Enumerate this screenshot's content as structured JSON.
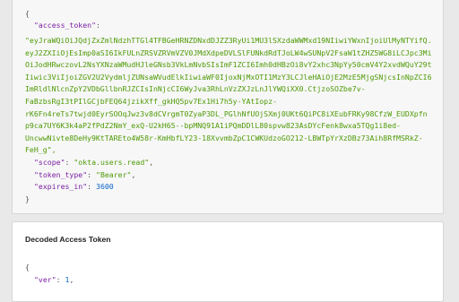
{
  "access_token_card": {
    "open_brace": "{",
    "close_brace": "}",
    "access_token_key": "\"access_token\"",
    "access_token_lines": [
      "\"eyJraWQiOiJQdjZxZmlNdzhTTGl4TFBGeHRNZDNxdDJZZ3RyUi1MU3lSXzdaWWMxd19NIiwiYWxnIjoiUlMyNTYifQ.",
      "eyJ2ZXIiOjEsImp0aSI6IkFULnZRSVZRVmVZV0JMdXdpeDVLSlFUNkdRdTJoLW4wSUNpV2FsaW1tZHZ5WG8iLCJpc3Mi",
      "OiJodHRwczovL2NsYXNzaWMudHJleGNsb3VkLmNvbSIsImF1ZCI6Imh0dHBzOi8vY2xhc3NpYy50cmV4Y2xvdWQuY29t",
      "Iiwic3ViIjoiZGV2U2VydmljZUNsaWVudElkIiwiaWF0IjoxNjMxOTI1MzY3LCJleHAiOjE2MzE5MjgSNjcsInNpZCI6",
      "ImRldlNlcnZpY2VDbGllbnRJZCIsInNjcCI6WyJva3RhLnVzZXJzLnJlYWQiXX0.CtjzoSOZbe7v-",
      "FaBzbsRgI3tPIlGCjbFEQ64jzikXff_gkHQ5pv7Ex1Hi7h5y-YAtIopz-",
      "rK6Fn4reTs7twjd0EyrSOOqJwz3v8dCVrgmT0ZyaP3DL_PGlhNfUOjSXmj0UKt6QiPC8iXEubFRKy98CfzW_EUDXpfn",
      "p9ca7UY6K3k4aP2fPdZ2NmY_exQ-U2kH65--bpMNQ91A1iPQmDDlL80spvw823AsDYcFenk8wxa5TQg1i8ed-",
      "UncwwNivte8DeHy9KtTAREto4W58r-KmHbfLY23-18XvvmbZpC1CWKUdzoGO212-LBWTpYrXzDBz73Aih8RfMSRkZ-",
      "FeH_g\","
    ],
    "scope_key": "\"scope\"",
    "scope_value": "\"okta.users.read\"",
    "token_type_key": "\"token_type\"",
    "token_type_value": "\"Bearer\"",
    "expires_in_key": "\"expires_in\"",
    "expires_in_value": "3600"
  },
  "decoded_card": {
    "title": "Decoded Access Token",
    "open_brace": "{",
    "ver_key": "\"ver\"",
    "ver_value": "1"
  },
  "colors": {
    "key": "#7a1fa2",
    "string": "#4e9a06",
    "number": "#0b63c9"
  }
}
